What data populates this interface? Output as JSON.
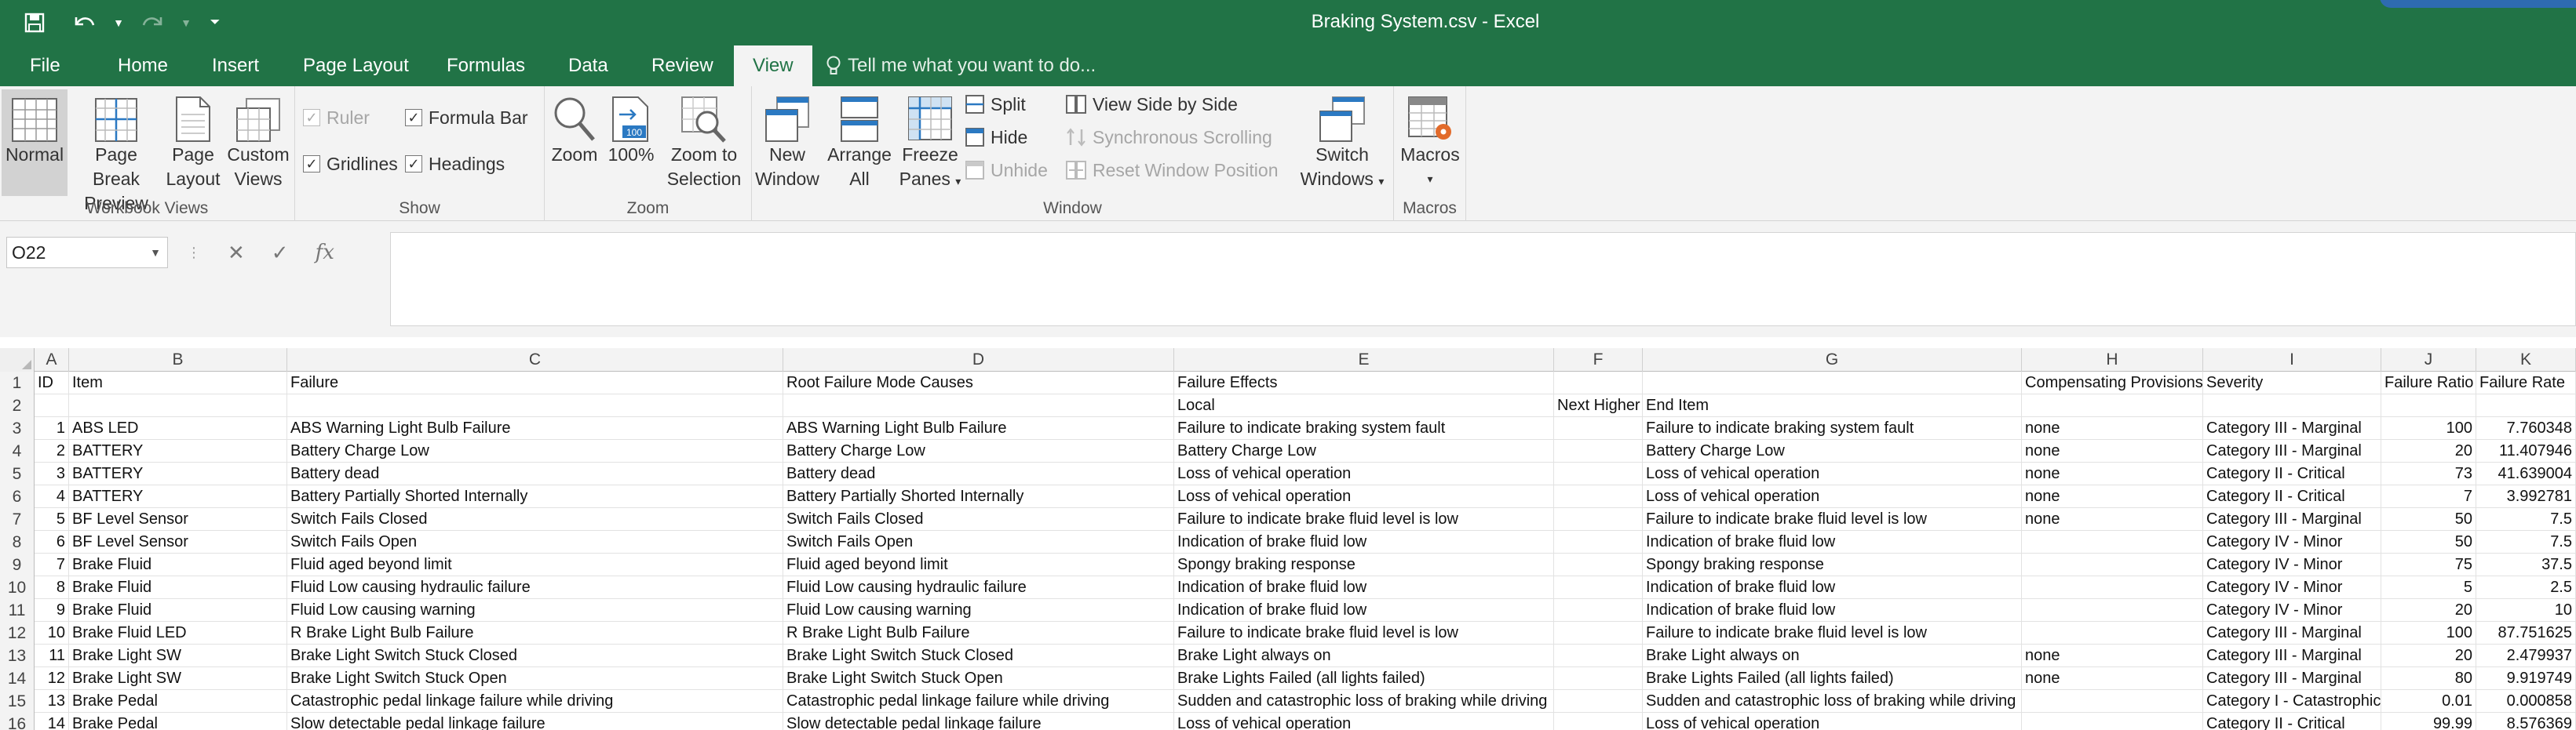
{
  "window": {
    "title": "Braking System.csv - Excel"
  },
  "quick_access": {
    "save": "save-icon",
    "undo": "undo-icon",
    "redo": "redo-icon",
    "customize": "customize-qat-icon"
  },
  "tabs": [
    "File",
    "Home",
    "Insert",
    "Page Layout",
    "Formulas",
    "Data",
    "Review",
    "View"
  ],
  "active_tab": "View",
  "tell_me": "Tell me what you want to do...",
  "ribbon": {
    "workbook_views": {
      "label": "Workbook Views",
      "normal": "Normal",
      "page_break_1": "Page Break",
      "page_break_2": "Preview",
      "page_layout_1": "Page",
      "page_layout_2": "Layout",
      "custom_views_1": "Custom",
      "custom_views_2": "Views"
    },
    "show": {
      "label": "Show",
      "ruler": "Ruler",
      "formula_bar": "Formula Bar",
      "gridlines": "Gridlines",
      "headings": "Headings"
    },
    "zoom": {
      "label": "Zoom",
      "zoom": "Zoom",
      "hundred": "100%",
      "zoom_sel_1": "Zoom to",
      "zoom_sel_2": "Selection"
    },
    "window": {
      "label": "Window",
      "new_window_1": "New",
      "new_window_2": "Window",
      "arrange_all_1": "Arrange",
      "arrange_all_2": "All",
      "freeze_1": "Freeze",
      "freeze_2": "Panes",
      "split": "Split",
      "hide": "Hide",
      "unhide": "Unhide",
      "side_by_side": "View Side by Side",
      "sync_scroll": "Synchronous Scrolling",
      "reset_pos": "Reset Window Position",
      "switch_1": "Switch",
      "switch_2": "Windows"
    },
    "macros": {
      "label": "Macros",
      "macros": "Macros"
    }
  },
  "formula_bar": {
    "name_box": "O22",
    "formula": ""
  },
  "columns": [
    "A",
    "B",
    "C",
    "D",
    "E",
    "F",
    "G",
    "H",
    "I",
    "J",
    "K"
  ],
  "rows": [
    {
      "n": "1",
      "c": [
        "ID",
        "Item",
        "Failure",
        "Root Failure Mode Causes",
        "Failure Effects",
        "",
        "",
        "Compensating Provisions",
        "Severity",
        "Failure Ratio",
        "Failure Rate"
      ]
    },
    {
      "n": "2",
      "c": [
        "",
        "",
        "",
        "",
        "Local",
        "Next Higher",
        "End Item",
        "",
        "",
        "",
        ""
      ]
    },
    {
      "n": "3",
      "c": [
        "1",
        "ABS LED",
        "ABS Warning Light Bulb Failure",
        "ABS Warning Light Bulb Failure",
        "Failure to indicate braking system fault",
        "",
        "Failure to indicate braking system fault",
        "none",
        "Category III - Marginal",
        "100",
        "7.760348"
      ]
    },
    {
      "n": "4",
      "c": [
        "2",
        "BATTERY",
        "Battery Charge Low",
        "Battery Charge Low",
        "Battery Charge Low",
        "",
        "Battery Charge Low",
        "none",
        "Category III - Marginal",
        "20",
        "11.407946"
      ]
    },
    {
      "n": "5",
      "c": [
        "3",
        "BATTERY",
        "Battery dead",
        "Battery dead",
        "Loss of vehical operation",
        "",
        "Loss of vehical operation",
        "none",
        "Category II - Critical",
        "73",
        "41.639004"
      ]
    },
    {
      "n": "6",
      "c": [
        "4",
        "BATTERY",
        "Battery Partially Shorted Internally",
        "Battery Partially Shorted Internally",
        "Loss of vehical operation",
        "",
        "Loss of vehical operation",
        "none",
        "Category II - Critical",
        "7",
        "3.992781"
      ]
    },
    {
      "n": "7",
      "c": [
        "5",
        "BF Level Sensor",
        "Switch Fails Closed",
        "Switch Fails Closed",
        "Failure to indicate brake fluid level is low",
        "",
        "Failure to indicate brake fluid level is low",
        "none",
        "Category III - Marginal",
        "50",
        "7.5"
      ]
    },
    {
      "n": "8",
      "c": [
        "6",
        "BF Level Sensor",
        "Switch Fails Open",
        "Switch Fails Open",
        "Indication of brake fluid low",
        "",
        "Indication of brake fluid low",
        "",
        "Category IV - Minor",
        "50",
        "7.5"
      ]
    },
    {
      "n": "9",
      "c": [
        "7",
        "Brake Fluid",
        "Fluid aged beyond limit",
        "Fluid aged beyond limit",
        "Spongy braking response",
        "",
        "Spongy braking response",
        "",
        "Category IV - Minor",
        "75",
        "37.5"
      ]
    },
    {
      "n": "10",
      "c": [
        "8",
        "Brake Fluid",
        "Fluid Low causing hydraulic failure",
        "Fluid Low causing hydraulic failure",
        "Indication of brake fluid low",
        "",
        "Indication of brake fluid low",
        "",
        "Category IV - Minor",
        "5",
        "2.5"
      ]
    },
    {
      "n": "11",
      "c": [
        "9",
        "Brake Fluid",
        "Fluid Low causing warning",
        "Fluid Low causing warning",
        "Indication of brake fluid low",
        "",
        "Indication of brake fluid low",
        "",
        "Category IV - Minor",
        "20",
        "10"
      ]
    },
    {
      "n": "12",
      "c": [
        "10",
        "Brake Fluid LED",
        "R Brake Light Bulb Failure",
        "R Brake Light Bulb Failure",
        "Failure to indicate brake fluid level is low",
        "",
        "Failure to indicate brake fluid level is low",
        "",
        "Category III - Marginal",
        "100",
        "87.751625"
      ]
    },
    {
      "n": "13",
      "c": [
        "11",
        "Brake Light SW",
        "Brake Light Switch Stuck Closed",
        "Brake Light Switch Stuck Closed",
        "Brake Light always on",
        "",
        "Brake Light always on",
        "none",
        "Category III - Marginal",
        "20",
        "2.479937"
      ]
    },
    {
      "n": "14",
      "c": [
        "12",
        "Brake Light SW",
        "Brake Light Switch Stuck Open",
        "Brake Light Switch Stuck Open",
        "Brake Lights Failed (all lights failed)",
        "",
        "Brake Lights Failed (all lights failed)",
        "none",
        "Category III - Marginal",
        "80",
        "9.919749"
      ]
    },
    {
      "n": "15",
      "c": [
        "13",
        "Brake Pedal",
        "Catastrophic pedal linkage failure while driving",
        "Catastrophic pedal linkage failure while driving",
        "Sudden and catastrophic loss of braking while driving",
        "",
        "Sudden and catastrophic loss of braking while driving",
        "",
        "Category I - Catastrophic",
        "0.01",
        "0.000858"
      ]
    },
    {
      "n": "16",
      "c": [
        "14",
        "Brake Pedal",
        "Slow detectable pedal linkage failure",
        "Slow detectable pedal linkage failure",
        "Loss of vehical operation",
        "",
        "Loss of vehical operation",
        "",
        "Category II - Critical",
        "99.99",
        "8.576369"
      ]
    }
  ]
}
